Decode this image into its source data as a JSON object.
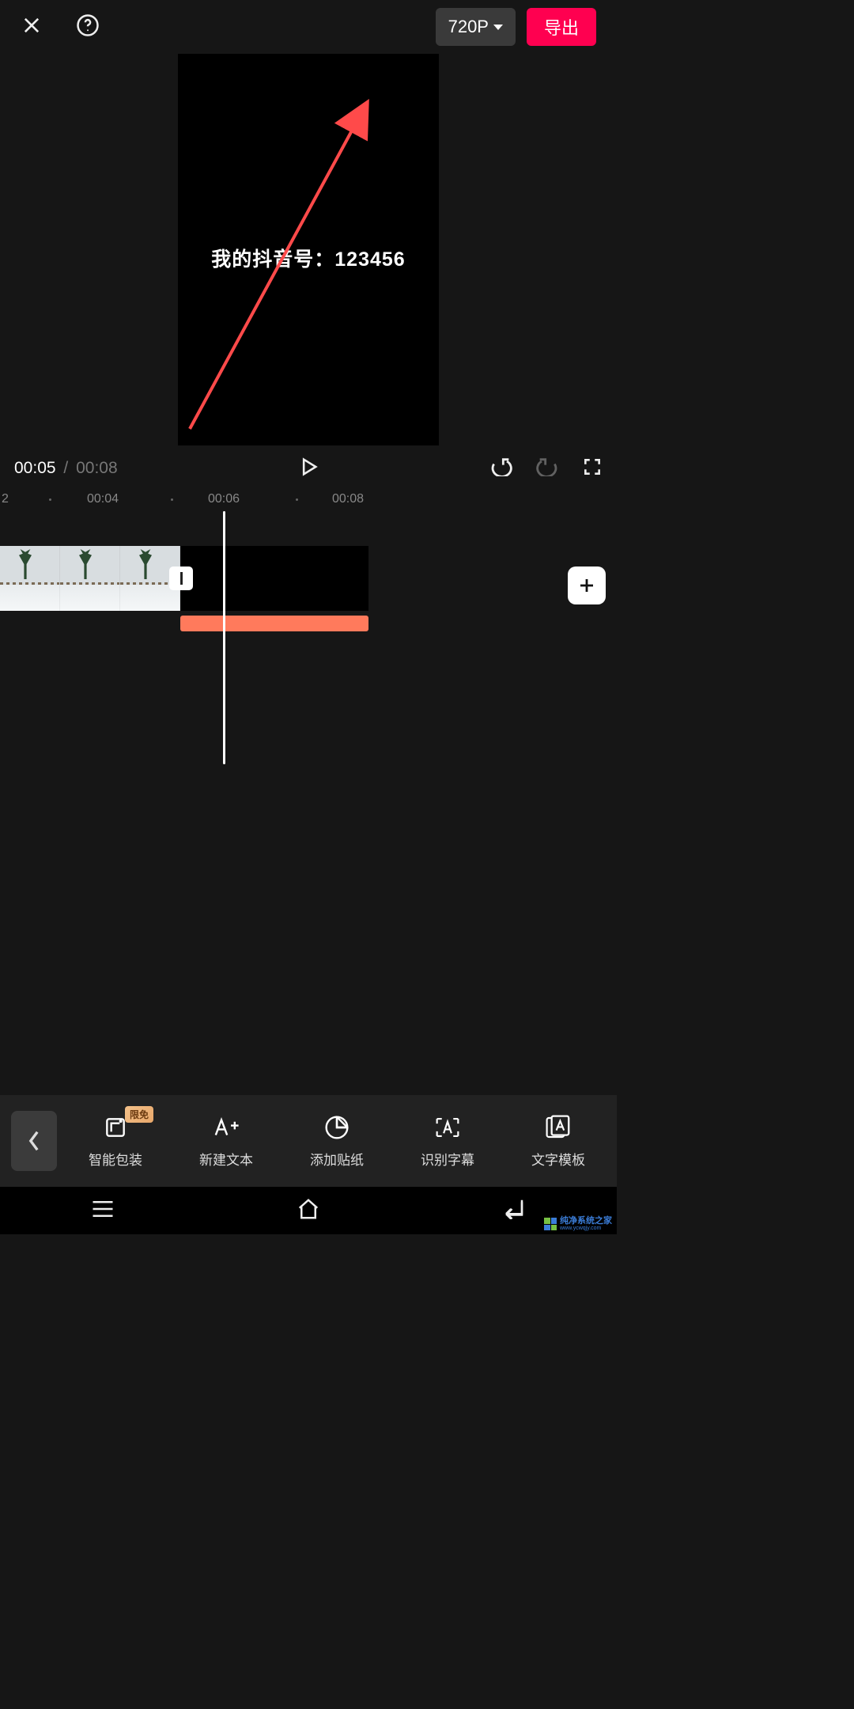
{
  "header": {
    "resolution_label": "720P",
    "export_label": "导出"
  },
  "preview": {
    "overlay_text": "我的抖音号：123456"
  },
  "playback": {
    "current_time": "00:05",
    "separator": "/",
    "total_time": "00:08"
  },
  "ruler": {
    "marks": [
      "2",
      "00:04",
      "00:06",
      "00:08"
    ],
    "mark_positions": [
      0,
      130,
      287,
      445
    ]
  },
  "toolbar": {
    "items": [
      {
        "label": "智能包装",
        "icon": "smart-template-icon",
        "badge": "限免"
      },
      {
        "label": "新建文本",
        "icon": "new-text-icon"
      },
      {
        "label": "添加贴纸",
        "icon": "sticker-icon"
      },
      {
        "label": "识别字幕",
        "icon": "subtitle-icon"
      },
      {
        "label": "文字模板",
        "icon": "text-template-icon"
      }
    ]
  },
  "watermark": {
    "name": "纯净系统之家",
    "url": "www.ycwqjy.com"
  }
}
